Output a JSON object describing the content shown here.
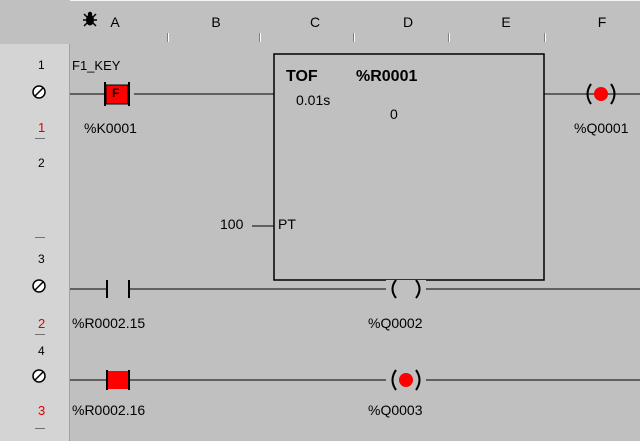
{
  "columns": [
    "A",
    "B",
    "C",
    "D",
    "E",
    "F"
  ],
  "row_numbers": [
    "1",
    "2",
    "3",
    "4"
  ],
  "rung_numbers": [
    "1",
    "2",
    "3"
  ],
  "icons": {
    "column_header": "bug-icon",
    "rung_marker": "no-power-circle-icon"
  },
  "rung1": {
    "contact_top_label": "F1_KEY",
    "contact_badge": "F",
    "contact_address": "%K0001",
    "timer_type": "TOF",
    "timer_register": "%R0001",
    "timer_base": "0.01s",
    "timer_current": "0",
    "preset_value": "100",
    "preset_pin": "PT",
    "coil_address": "%Q0001"
  },
  "rung2": {
    "contact_address": "%R0002.15",
    "coil_symbol": "( )",
    "coil_address": "%Q0002"
  },
  "rung3": {
    "contact_address": "%R0002.16",
    "coil_address": "%Q0003"
  },
  "colors": {
    "active": "#ff0000",
    "rail": "#000000",
    "background": "#c0c0c0"
  }
}
